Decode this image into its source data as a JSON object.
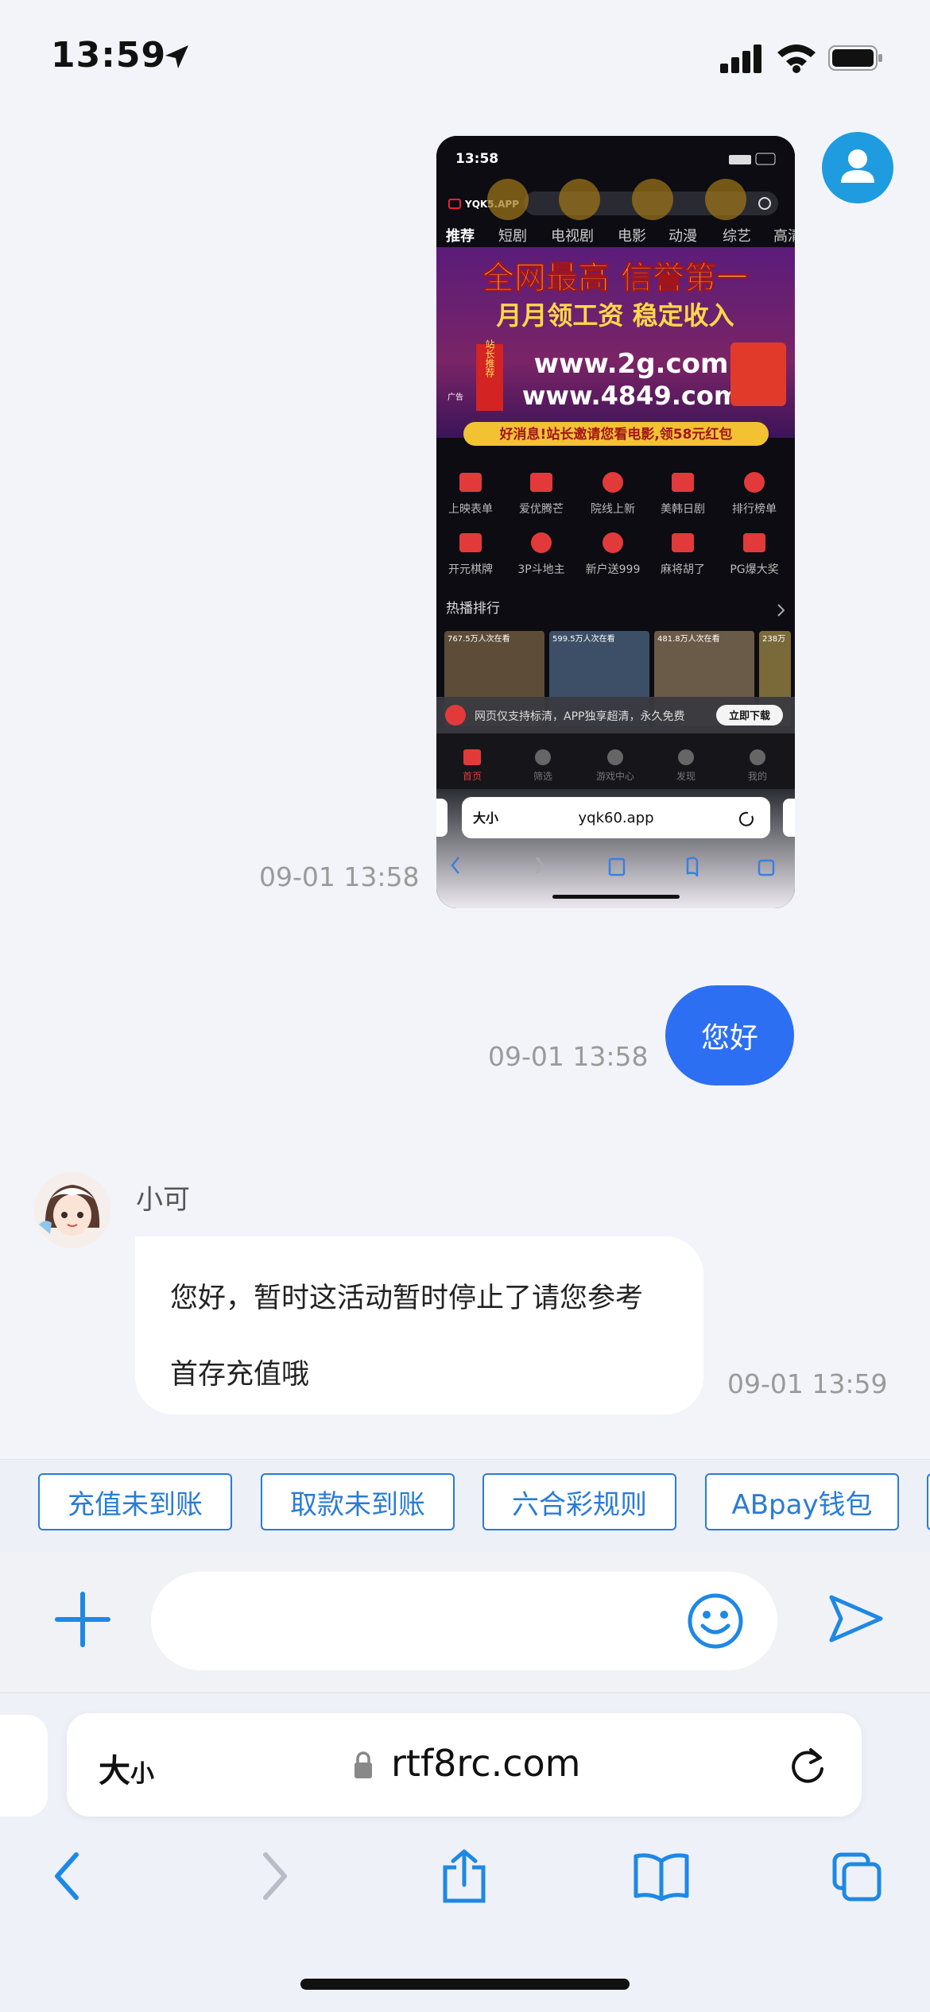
{
  "status_bar": {
    "time": "13:59"
  },
  "chat": {
    "messages": [
      {
        "type": "image",
        "sender": "me",
        "time": "09-01 13:58"
      },
      {
        "type": "text",
        "sender": "me",
        "text": "您好",
        "time": "09-01 13:58"
      },
      {
        "type": "text",
        "sender": "agent",
        "name": "小可",
        "text": "您好，暂时这活动暂时停止了请您参考首存充值哦",
        "time": "09-01 13:59"
      }
    ]
  },
  "screenshot": {
    "time": "13:58",
    "app_name": "YQK5.APP",
    "tabs": [
      "推荐",
      "短剧",
      "电视剧",
      "电影",
      "动漫",
      "综艺",
      "高清"
    ],
    "banner": {
      "headline": "全网最高 信誉第一",
      "subline": "月月领工资 稳定收入",
      "side_tag": "站长推荐",
      "url1": "www.2g.com",
      "url2": "www.4849.com",
      "ad_label": "广告",
      "promo": "好消息!站长邀请您看电影,领58元红包"
    },
    "grid_row1": [
      "上映表单",
      "爱优腾芒",
      "院线上新",
      "美韩日剧",
      "排行榜单"
    ],
    "grid_row2": [
      "开元棋牌",
      "3P斗地主",
      "新户送999",
      "麻将胡了",
      "PG爆大奖"
    ],
    "hot_title": "热播排行",
    "hot_counts": [
      "767.5万人次在看",
      "599.5万人次在看",
      "481.8万人次在看",
      "238万"
    ],
    "hd_badge": "高清",
    "app_banner_text": "网页仅支持标清，APP独享超清，永久免费",
    "download_label": "立即下载",
    "bottom_tabs": [
      "首页",
      "筛选",
      "游戏中心",
      "发现",
      "我的"
    ],
    "url_size": "大小",
    "url": "yqk60.app"
  },
  "quick_replies": [
    "充值未到账",
    "取款未到账",
    "六合彩规则",
    "ABpay钱包"
  ],
  "composer": {
    "placeholder": ""
  },
  "browser": {
    "text_size_big": "大",
    "text_size_small": "小",
    "url": "rtf8rc.com"
  },
  "colors": {
    "accent": "#2d6ff2",
    "quick_reply": "#2a7bd6",
    "icon_blue": "#1e88e5"
  }
}
